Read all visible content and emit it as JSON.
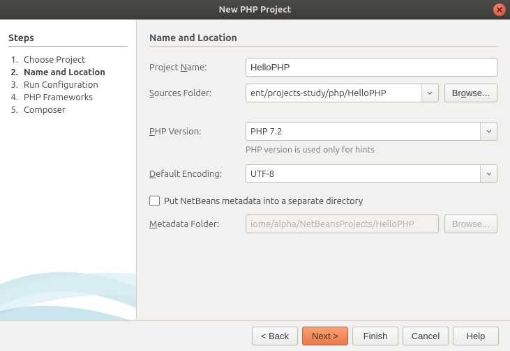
{
  "window": {
    "title": "New PHP Project"
  },
  "sidebar": {
    "heading": "Steps",
    "steps": [
      {
        "num": "1.",
        "label": "Choose Project",
        "current": false
      },
      {
        "num": "2.",
        "label": "Name and Location",
        "current": true
      },
      {
        "num": "3.",
        "label": "Run Configuration",
        "current": false
      },
      {
        "num": "4.",
        "label": "PHP Frameworks",
        "current": false
      },
      {
        "num": "5.",
        "label": "Composer",
        "current": false
      }
    ]
  },
  "main": {
    "heading": "Name and Location",
    "projectName": {
      "label": "Project Name:",
      "accel": "N",
      "value": "HelloPHP"
    },
    "sourcesFolder": {
      "label": "Sources Folder:",
      "accel": "S",
      "value": "ent/projects-study/php/HelloPHP",
      "browse": "Browse..."
    },
    "phpVersion": {
      "label": "PHP Version:",
      "accel": "P",
      "value": "PHP 7.2"
    },
    "phpHint": "PHP version is used only for hints",
    "encoding": {
      "label": "Default Encoding:",
      "accel": "D",
      "value": "UTF-8"
    },
    "separateMeta": {
      "label": "Put NetBeans metadata into a separate directory",
      "accel": "P",
      "checked": false
    },
    "metaFolder": {
      "label": "Metadata Folder:",
      "accel": "M",
      "value": "iome/alpha/NetBeansProjects/HelloPHP",
      "browse": "Browse..."
    }
  },
  "footer": {
    "back": "< Back",
    "next": "Next >",
    "finish": "Finish",
    "cancel": "Cancel",
    "help": "Help"
  }
}
